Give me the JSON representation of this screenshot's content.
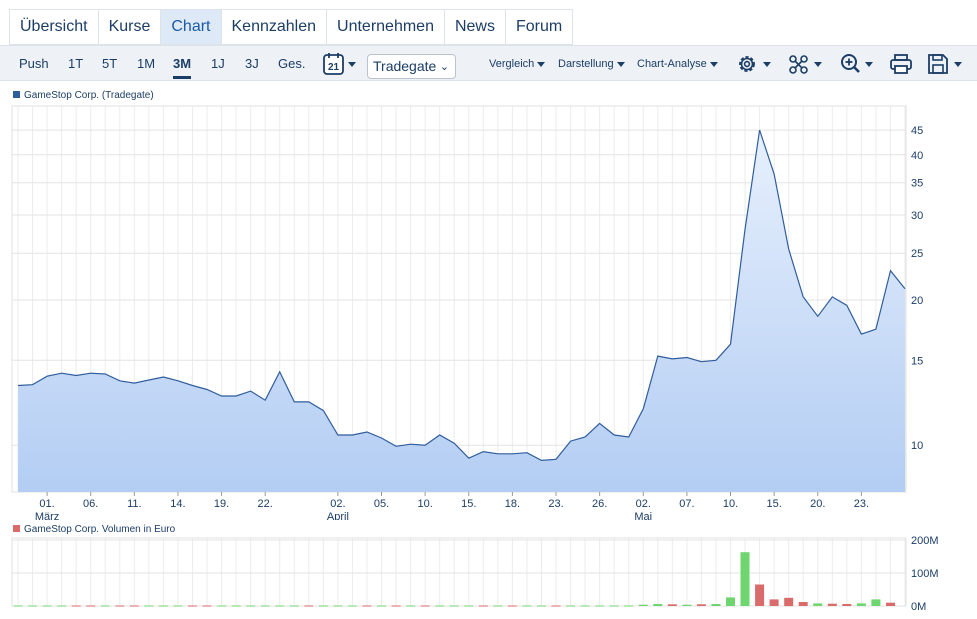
{
  "tabs": [
    {
      "label": "Übersicht"
    },
    {
      "label": "Kurse"
    },
    {
      "label": "Chart"
    },
    {
      "label": "Kennzahlen"
    },
    {
      "label": "Unternehmen"
    },
    {
      "label": "News"
    },
    {
      "label": "Forum"
    }
  ],
  "toolbar": {
    "ranges": [
      "Push",
      "1T",
      "5T",
      "1M",
      "3M",
      "1J",
      "3J",
      "Ges."
    ],
    "active_range": "3M",
    "calendar_day": "21",
    "exchange": "Tradegate",
    "menus": [
      "Vergleich",
      "Darstellung",
      "Chart-Analyse"
    ],
    "tools": [
      "settings-icon",
      "indicators-icon",
      "zoom-icon",
      "print-icon",
      "save-icon"
    ]
  },
  "colors": {
    "line": "#2f5d9c",
    "area_top": "#e7f0fd",
    "area_bottom": "#b3cdf3",
    "vol_up": "#6fd66f",
    "vol_down": "#d96b6b",
    "grid": "#e0e0e0"
  },
  "chart_data": [
    {
      "type": "area",
      "legend": "GameStop Corp. (Tradegate)",
      "scale": "log",
      "ylim": [
        8,
        50
      ],
      "yticks": [
        10,
        15,
        20,
        25,
        30,
        35,
        40,
        45
      ],
      "x_tick_labels": [
        "01.",
        "06.",
        "11.",
        "14.",
        "19.",
        "22.",
        "02.",
        "05.",
        "10.",
        "15.",
        "18.",
        "23.",
        "26.",
        "02.",
        "07.",
        "10.",
        "15.",
        "20.",
        "23."
      ],
      "x_tick_index": [
        2,
        5,
        8,
        11,
        14,
        17,
        22,
        25,
        28,
        31,
        34,
        37,
        40,
        43,
        46,
        49,
        52,
        55,
        58
      ],
      "month_labels": [
        {
          "label": "März",
          "index": 2
        },
        {
          "label": "April",
          "index": 22
        },
        {
          "label": "Mai",
          "index": 43
        }
      ],
      "values": [
        13.3,
        13.35,
        13.9,
        14.1,
        13.95,
        14.1,
        14.05,
        13.6,
        13.45,
        13.65,
        13.85,
        13.6,
        13.3,
        13.05,
        12.65,
        12.65,
        12.95,
        12.4,
        14.2,
        12.3,
        12.3,
        11.8,
        10.5,
        10.5,
        10.65,
        10.35,
        9.95,
        10.05,
        10.0,
        10.5,
        10.1,
        9.4,
        9.7,
        9.6,
        9.6,
        9.65,
        9.3,
        9.35,
        10.2,
        10.4,
        11.1,
        10.5,
        10.4,
        11.9,
        15.3,
        15.1,
        15.2,
        14.9,
        15.0,
        16.2,
        28.0,
        45.0,
        36.5,
        25.5,
        20.3,
        18.5,
        20.3,
        19.5,
        17.0,
        17.4,
        23.0,
        21.1
      ]
    },
    {
      "type": "bar",
      "legend": "GameStop Corp. Volumen in Euro",
      "ylim": [
        0,
        200
      ],
      "ytick_labels": [
        "200M",
        "100M",
        "0M"
      ],
      "yticks": [
        200,
        100,
        0
      ],
      "values_m": [
        1.5,
        1.5,
        1.5,
        1.5,
        1.5,
        1.5,
        1.5,
        1.5,
        1.5,
        1.5,
        1.5,
        1.5,
        1.5,
        1.5,
        1.5,
        1.5,
        1.5,
        1.5,
        1.5,
        1.5,
        1.5,
        1.5,
        1.5,
        1.5,
        1.5,
        1.5,
        1.5,
        1.5,
        1.5,
        1.5,
        1.5,
        1.5,
        1.5,
        1.5,
        1.5,
        1.5,
        1.5,
        1.5,
        1.5,
        1.5,
        1.5,
        1.5,
        1.5,
        4,
        6,
        5,
        4,
        5,
        6,
        26,
        163,
        65,
        20,
        25,
        12,
        8,
        7,
        6,
        8,
        20,
        10
      ],
      "up_flags": [
        1,
        1,
        1,
        1,
        0,
        0,
        1,
        0,
        0,
        1,
        1,
        1,
        0,
        0,
        1,
        1,
        1,
        1,
        1,
        1,
        0,
        1,
        1,
        1,
        0,
        1,
        0,
        1,
        0,
        1,
        1,
        1,
        0,
        1,
        0,
        1,
        1,
        0,
        1,
        1,
        1,
        1,
        1,
        1,
        1,
        0,
        1,
        0,
        1,
        1,
        1,
        0,
        0,
        0,
        0,
        1,
        0,
        0,
        1,
        1,
        0
      ]
    }
  ]
}
